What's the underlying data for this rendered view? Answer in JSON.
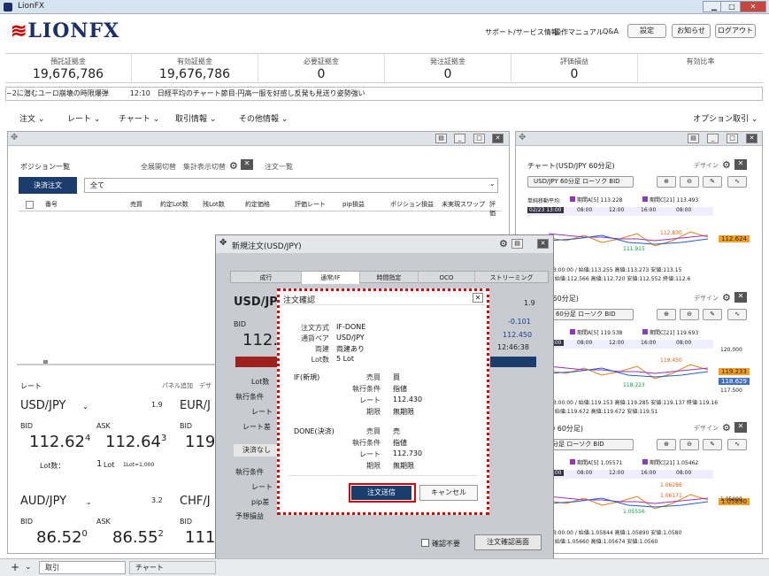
{
  "window": {
    "title": "LionFX",
    "min": "▁",
    "max": "□",
    "close": "✕"
  },
  "header": {
    "logo": "LIONFX",
    "links": [
      "サポート/サービス情報",
      "操作マニュアル",
      "Q&A"
    ],
    "buttons": [
      "設定",
      "お知らせ",
      "ログアウト"
    ]
  },
  "summary": [
    {
      "label": "預託証拠金",
      "value": "19,676,786"
    },
    {
      "label": "有効証拠金",
      "value": "19,676,786"
    },
    {
      "label": "必要証拠金",
      "value": "0"
    },
    {
      "label": "発注証拠金",
      "value": "0"
    },
    {
      "label": "評価損益",
      "value": "0"
    },
    {
      "label": "有効比率",
      "value": ""
    }
  ],
  "news": "~2に潜むユーロ崩壊の時限爆弾　　　12:10　日経平均のチャート節目-円高一服を好感し反発も見送り姿勢強い",
  "menu": [
    "注文 ⌄",
    "レート ⌄",
    "チャート ⌄",
    "取引情報 ⌄",
    "その他情報 ⌄",
    "オプション取引 ⌄"
  ],
  "positions": {
    "title": "ポジション一覧",
    "toggle1": "全展開切替",
    "toggle2": "集計表示切替",
    "tab2": "注文一覧",
    "settle_btn": "決済注文",
    "filter": "全て",
    "columns": [
      "番号",
      "売買",
      "約定Lot数",
      "残Lot数",
      "約定価格",
      "評価レート",
      "pip損益",
      "ポジション損益",
      "未実現スワップ",
      "評価"
    ]
  },
  "rates": {
    "title": "レート",
    "add": "パネル追加",
    "design": "デザ",
    "pairs": [
      {
        "name": "USD/JPY",
        "spread": "1.9",
        "bid_label": "BID",
        "ask_label": "ASK",
        "bid_main": "112.62",
        "bid_sup": "4",
        "ask_main": "112.64",
        "ask_sup": "3",
        "lot_label": "Lot数：",
        "lot": "1",
        "lot_unit": "Lot",
        "lot_note": "1Lot=1,000"
      },
      {
        "name": "EUR/J",
        "spread": "",
        "bid_label": "BID",
        "bid_main": "119."
      },
      {
        "name": "AUD/JPY",
        "spread": "3.2",
        "bid_label": "BID",
        "ask_label": "ASK",
        "bid_main": "86.52",
        "bid_sup": "0",
        "ask_main": "86.55",
        "ask_sup": "2"
      },
      {
        "name": "CHF/J",
        "bid_label": "BID",
        "bid_main": "111"
      }
    ]
  },
  "order_window": {
    "title": "新規注文(USD/JPY)",
    "tabs": [
      "成行",
      "通常/IF",
      "時間指定",
      "OCO",
      "ストリーミング"
    ],
    "pair": "USD/JP",
    "spread": "1.9",
    "bid_label": "BID",
    "bid_price": "112.6",
    "change": "-0.101",
    "high": "112.450",
    "time": "12:46:38",
    "labels": [
      "Lot数",
      "執行条件",
      "レート",
      "レート差"
    ],
    "settle_label": "決済なし",
    "labels2": [
      "執行条件",
      "レート",
      "pip差",
      "予想損益"
    ],
    "confirm_check": "確認不要",
    "confirm_btn": "注文確認画面"
  },
  "dialog": {
    "title": "注文確認",
    "close": "✕",
    "rows": [
      {
        "label": "注文方式",
        "value": "IF-DONE"
      },
      {
        "label": "通貨ペア",
        "value": "USD/JPY"
      },
      {
        "label": "両建",
        "value": "両建あり"
      },
      {
        "label": "Lot数",
        "value": "5 Lot"
      }
    ],
    "if_label": "IF(新規)",
    "if_rows": [
      {
        "label": "売買",
        "value": "買"
      },
      {
        "label": "執行条件",
        "value": "指値"
      },
      {
        "label": "レート",
        "value": "112.430"
      },
      {
        "label": "期限",
        "value": "無期限"
      }
    ],
    "done_label": "DONE(決済)",
    "done_rows": [
      {
        "label": "売買",
        "value": "売"
      },
      {
        "label": "執行条件",
        "value": "指値"
      },
      {
        "label": "レート",
        "value": "112.730"
      },
      {
        "label": "期限",
        "value": "無期限"
      }
    ],
    "send": "注文送信",
    "cancel": "キャンセル"
  },
  "charts": [
    {
      "title": "チャート(USD/JPY 60分足)",
      "design": "デザイン",
      "selector": "USD/JPY 60分足 ローソク BID",
      "legend": "単純移動平均:",
      "ma1": "期間A[5] 113.228",
      "ma2": "期間C[21] 113.493",
      "times": [
        "02/23 13:00",
        "08:00",
        "12:00",
        "16:00",
        "08:00"
      ],
      "price": "112.624",
      "hi": "112.830",
      "lo": "111.915",
      "footer": "702/28 13:00:00 / 始値:113.255 高値:113.273 安値:113.15",
      "footer2": "12:00:00 始値:112.566 高値:112.720 安値:112.552 終値:112.6"
    },
    {
      "title": "UR/JPY 60分足)",
      "design": "デザイン",
      "selector": "UR/JPY 60分足 ローソク BID",
      "ma1": "期間A[5] 119.538",
      "ma2": "期間C[21] 119.693",
      "times": [
        "02/23 13:00",
        "08:00",
        "12:00",
        "16:00",
        "08:00"
      ],
      "price": "119.233",
      "p2": "118.629",
      "hi": "119.450",
      "lo": "118.223",
      "axis": [
        "120.000",
        "117.500"
      ],
      "footer": "702/28 13:00:00 / 始値:119.153 高値:119.285 安値:119.137 終値:119.16",
      "footer2": "12:00:00 始値:119.672 高値:119.672 安値:119.51"
    },
    {
      "title": "UR/USD 60分足)",
      "design": "デザイン",
      "selector": "SD 60分足 ローソク BID",
      "ma1": "期間A[5] 1.05571",
      "ma2": "期間C[21] 1.05462",
      "times": [
        "02/23 13:00",
        "08:00",
        "12:00",
        "16:00",
        "08:00"
      ],
      "price": "1.05890",
      "hi": "1.06171",
      "hi2": "1.06286",
      "lo": "1.05556",
      "axis": [
        "1.05000"
      ],
      "footer": "702/28 13:00:00 / 始値:1.05844 高値:1.05890 安値:1.0580",
      "footer2": "12:00:00 始値:1.05660 高値:1.05674 安値:1.0560"
    }
  ],
  "statusbar": {
    "tab1": "取引",
    "tab2": "チャート"
  }
}
